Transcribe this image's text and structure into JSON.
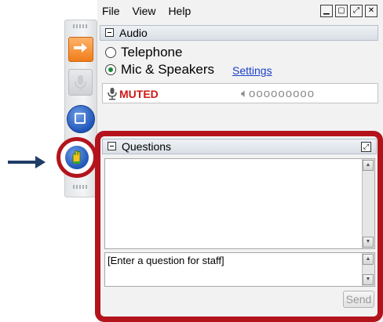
{
  "menu": {
    "file": "File",
    "view": "View",
    "help": "Help"
  },
  "window_controls": {
    "minimize_icon": "minimize-icon",
    "restore_icon": "restore-icon",
    "popout_icon": "popout-icon",
    "close_icon": "close-icon"
  },
  "audio": {
    "title": "Audio",
    "telephone_label": "Telephone",
    "mic_label": "Mic & Speakers",
    "selected": "Mic & Speakers",
    "settings_link": "Settings",
    "muted_label": "MUTED",
    "volume_level": 0
  },
  "questions": {
    "title": "Questions",
    "input_placeholder": "[Enter a question for staff]",
    "send_label": "Send"
  },
  "colors": {
    "highlight": "#b3141c",
    "arrow": "#1f3d66",
    "muted_text": "#d01818",
    "link": "#1a3ecc"
  },
  "toolbar": {
    "icons": [
      "forward-arrow-icon",
      "microphone-icon",
      "screen-icon",
      "raise-hand-icon"
    ]
  }
}
